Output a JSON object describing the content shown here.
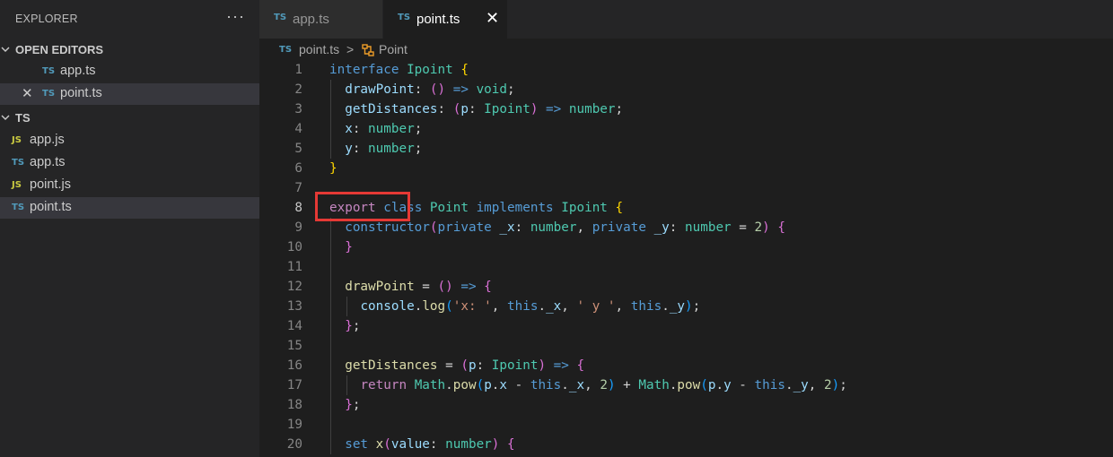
{
  "sidebar": {
    "title": "EXPLORER",
    "more": "···",
    "open_editors": {
      "label": "OPEN EDITORS",
      "items": [
        {
          "icon": "TS",
          "name": "app.ts"
        },
        {
          "icon": "TS",
          "name": "point.ts",
          "close": "✕"
        }
      ]
    },
    "folder": {
      "label": "TS",
      "files": [
        {
          "icon": "JS",
          "name": "app.js"
        },
        {
          "icon": "TS",
          "name": "app.ts"
        },
        {
          "icon": "JS",
          "name": "point.js"
        },
        {
          "icon": "TS",
          "name": "point.ts"
        }
      ]
    }
  },
  "tabs": [
    {
      "icon": "TS",
      "label": "app.ts"
    },
    {
      "icon": "TS",
      "label": "point.ts",
      "close": "✕"
    }
  ],
  "breadcrumb": {
    "icon": "TS",
    "file": "point.ts",
    "separator": ">",
    "symbol": "Point"
  },
  "code": {
    "active_line": 8,
    "lines": [
      {
        "n": "1",
        "tokens": [
          [
            "kw-storage",
            "interface"
          ],
          [
            "punc",
            " "
          ],
          [
            "type",
            "Ipoint"
          ],
          [
            "punc",
            " "
          ],
          [
            "b1",
            "{"
          ]
        ]
      },
      {
        "n": "2",
        "tokens": [
          [
            "punc",
            "  "
          ],
          [
            "prop",
            "drawPoint"
          ],
          [
            "punc",
            ": "
          ],
          [
            "b2",
            "()"
          ],
          [
            "punc",
            " "
          ],
          [
            "kw-storage",
            "=>"
          ],
          [
            "punc",
            " "
          ],
          [
            "type",
            "void"
          ],
          [
            "punc",
            ";"
          ]
        ]
      },
      {
        "n": "3",
        "tokens": [
          [
            "punc",
            "  "
          ],
          [
            "prop",
            "getDistances"
          ],
          [
            "punc",
            ": "
          ],
          [
            "b2",
            "("
          ],
          [
            "prop",
            "p"
          ],
          [
            "punc",
            ": "
          ],
          [
            "type",
            "Ipoint"
          ],
          [
            "b2",
            ")"
          ],
          [
            "punc",
            " "
          ],
          [
            "kw-storage",
            "=>"
          ],
          [
            "punc",
            " "
          ],
          [
            "type",
            "number"
          ],
          [
            "punc",
            ";"
          ]
        ]
      },
      {
        "n": "4",
        "tokens": [
          [
            "punc",
            "  "
          ],
          [
            "prop",
            "x"
          ],
          [
            "punc",
            ": "
          ],
          [
            "type",
            "number"
          ],
          [
            "punc",
            ";"
          ]
        ]
      },
      {
        "n": "5",
        "tokens": [
          [
            "punc",
            "  "
          ],
          [
            "prop",
            "y"
          ],
          [
            "punc",
            ": "
          ],
          [
            "type",
            "number"
          ],
          [
            "punc",
            ";"
          ]
        ]
      },
      {
        "n": "6",
        "tokens": [
          [
            "b1",
            "}"
          ]
        ]
      },
      {
        "n": "7",
        "tokens": []
      },
      {
        "n": "8",
        "tokens": [
          [
            "kw-ctrl",
            "export"
          ],
          [
            "punc",
            " "
          ],
          [
            "kw-storage",
            "class"
          ],
          [
            "punc",
            " "
          ],
          [
            "type",
            "Point"
          ],
          [
            "punc",
            " "
          ],
          [
            "kw-storage",
            "implements"
          ],
          [
            "punc",
            " "
          ],
          [
            "type",
            "Ipoint"
          ],
          [
            "punc",
            " "
          ],
          [
            "b1",
            "{"
          ]
        ]
      },
      {
        "n": "9",
        "tokens": [
          [
            "punc",
            "  "
          ],
          [
            "kw-storage",
            "constructor"
          ],
          [
            "b2",
            "("
          ],
          [
            "kw-storage",
            "private"
          ],
          [
            "punc",
            " "
          ],
          [
            "prop",
            "_x"
          ],
          [
            "punc",
            ": "
          ],
          [
            "type",
            "number"
          ],
          [
            "punc",
            ", "
          ],
          [
            "kw-storage",
            "private"
          ],
          [
            "punc",
            " "
          ],
          [
            "prop",
            "_y"
          ],
          [
            "punc",
            ": "
          ],
          [
            "type",
            "number"
          ],
          [
            "punc",
            " = "
          ],
          [
            "num",
            "2"
          ],
          [
            "b2",
            ")"
          ],
          [
            "punc",
            " "
          ],
          [
            "b2",
            "{"
          ]
        ]
      },
      {
        "n": "10",
        "tokens": [
          [
            "punc",
            "  "
          ],
          [
            "b2",
            "}"
          ]
        ]
      },
      {
        "n": "11",
        "tokens": []
      },
      {
        "n": "12",
        "tokens": [
          [
            "punc",
            "  "
          ],
          [
            "fn",
            "drawPoint"
          ],
          [
            "punc",
            " = "
          ],
          [
            "b2",
            "()"
          ],
          [
            "punc",
            " "
          ],
          [
            "kw-storage",
            "=>"
          ],
          [
            "punc",
            " "
          ],
          [
            "b2",
            "{"
          ]
        ]
      },
      {
        "n": "13",
        "tokens": [
          [
            "punc",
            "    "
          ],
          [
            "prop",
            "console"
          ],
          [
            "punc",
            "."
          ],
          [
            "fn",
            "log"
          ],
          [
            "b3",
            "("
          ],
          [
            "str",
            "'x: '"
          ],
          [
            "punc",
            ", "
          ],
          [
            "kw-storage",
            "this"
          ],
          [
            "punc",
            "."
          ],
          [
            "prop",
            "_x"
          ],
          [
            "punc",
            ", "
          ],
          [
            "str",
            "' y '"
          ],
          [
            "punc",
            ", "
          ],
          [
            "kw-storage",
            "this"
          ],
          [
            "punc",
            "."
          ],
          [
            "prop",
            "_y"
          ],
          [
            "b3",
            ")"
          ],
          [
            "punc",
            ";"
          ]
        ]
      },
      {
        "n": "14",
        "tokens": [
          [
            "punc",
            "  "
          ],
          [
            "b2",
            "}"
          ],
          [
            "punc",
            ";"
          ]
        ]
      },
      {
        "n": "15",
        "tokens": []
      },
      {
        "n": "16",
        "tokens": [
          [
            "punc",
            "  "
          ],
          [
            "fn",
            "getDistances"
          ],
          [
            "punc",
            " = "
          ],
          [
            "b2",
            "("
          ],
          [
            "prop",
            "p"
          ],
          [
            "punc",
            ": "
          ],
          [
            "type",
            "Ipoint"
          ],
          [
            "b2",
            ")"
          ],
          [
            "punc",
            " "
          ],
          [
            "kw-storage",
            "=>"
          ],
          [
            "punc",
            " "
          ],
          [
            "b2",
            "{"
          ]
        ]
      },
      {
        "n": "17",
        "tokens": [
          [
            "punc",
            "    "
          ],
          [
            "kw-ctrl",
            "return"
          ],
          [
            "punc",
            " "
          ],
          [
            "type",
            "Math"
          ],
          [
            "punc",
            "."
          ],
          [
            "fn",
            "pow"
          ],
          [
            "b3",
            "("
          ],
          [
            "prop",
            "p"
          ],
          [
            "punc",
            "."
          ],
          [
            "prop",
            "x"
          ],
          [
            "punc",
            " - "
          ],
          [
            "kw-storage",
            "this"
          ],
          [
            "punc",
            "."
          ],
          [
            "prop",
            "_x"
          ],
          [
            "punc",
            ", "
          ],
          [
            "num",
            "2"
          ],
          [
            "b3",
            ")"
          ],
          [
            "punc",
            " + "
          ],
          [
            "type",
            "Math"
          ],
          [
            "punc",
            "."
          ],
          [
            "fn",
            "pow"
          ],
          [
            "b3",
            "("
          ],
          [
            "prop",
            "p"
          ],
          [
            "punc",
            "."
          ],
          [
            "prop",
            "y"
          ],
          [
            "punc",
            " - "
          ],
          [
            "kw-storage",
            "this"
          ],
          [
            "punc",
            "."
          ],
          [
            "prop",
            "_y"
          ],
          [
            "punc",
            ", "
          ],
          [
            "num",
            "2"
          ],
          [
            "b3",
            ")"
          ],
          [
            "punc",
            ";"
          ]
        ]
      },
      {
        "n": "18",
        "tokens": [
          [
            "punc",
            "  "
          ],
          [
            "b2",
            "}"
          ],
          [
            "punc",
            ";"
          ]
        ]
      },
      {
        "n": "19",
        "tokens": []
      },
      {
        "n": "20",
        "tokens": [
          [
            "punc",
            "  "
          ],
          [
            "kw-storage",
            "set"
          ],
          [
            "punc",
            " "
          ],
          [
            "fn",
            "x"
          ],
          [
            "b2",
            "("
          ],
          [
            "prop",
            "value"
          ],
          [
            "punc",
            ": "
          ],
          [
            "type",
            "number"
          ],
          [
            "b2",
            ")"
          ],
          [
            "punc",
            " "
          ],
          [
            "b2",
            "{"
          ]
        ]
      }
    ]
  },
  "colors": {
    "accent_highlight": "#e53935",
    "background": "#1e1e1e",
    "sidebar": "#252526",
    "selection": "#37373d"
  },
  "icons": {
    "chevron": "chevron-down-icon",
    "symbol": "class-symbol-icon",
    "close": "close-icon",
    "more": "more-icon"
  }
}
